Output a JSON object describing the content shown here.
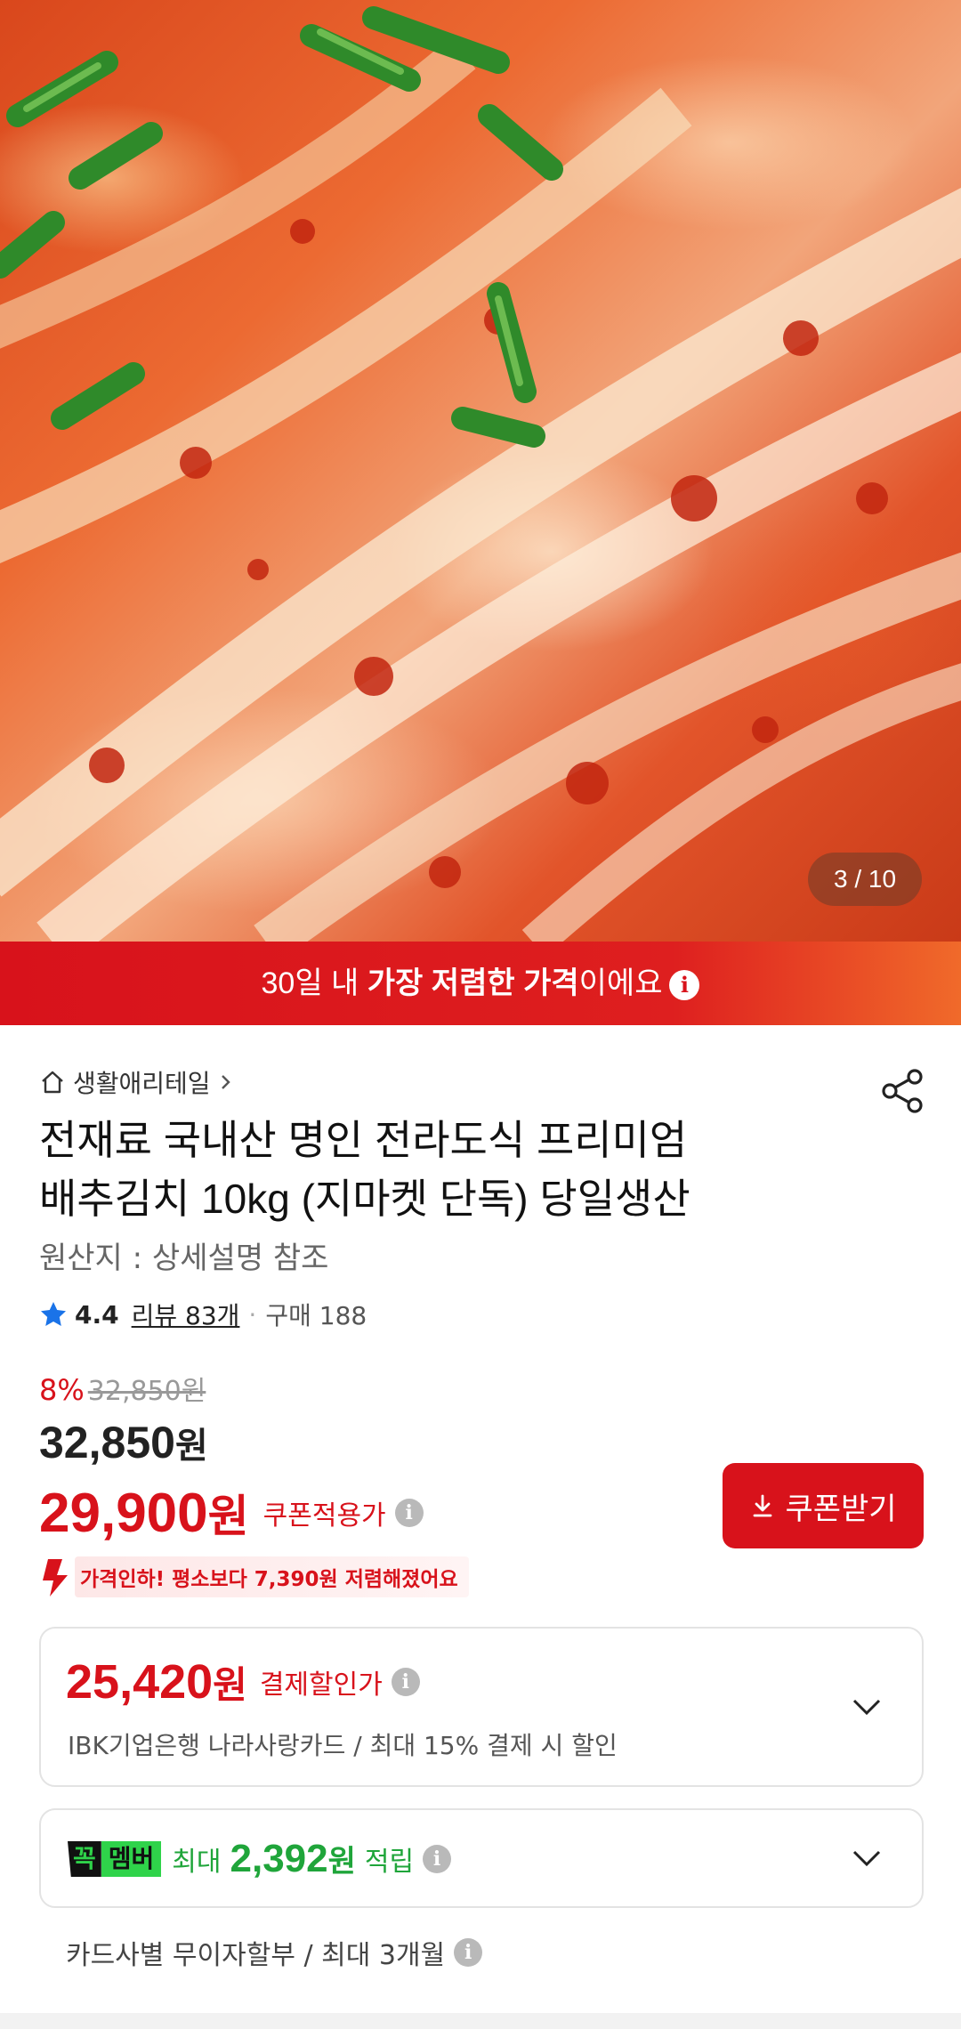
{
  "gallery": {
    "indicator": "3 / 10"
  },
  "banner": {
    "prefix": "30일 내 ",
    "highlight": "가장 저렴한 가격",
    "suffix": "이에요",
    "info_glyph": "i"
  },
  "seller": {
    "name": "생활애리테일",
    "icon": "home-icon"
  },
  "product": {
    "title_line1": "전재료 국내산 명인 전라도식 프리미엄",
    "title_line2": "배추김치 10kg  (지마켓 단독) 당일생산",
    "origin": "원산지 : 상세설명 참조"
  },
  "rating": {
    "score": "4.4",
    "review_link": "리뷰 83개",
    "separator": "·",
    "purchases": "구매 188"
  },
  "price": {
    "discount_rate": "8%",
    "original": "32,850원",
    "sale_amount": "32,850",
    "sale_unit": "원",
    "coupon_amount": "29,900",
    "coupon_unit": "원",
    "coupon_label": "쿠폰적용가",
    "price_drop": "가격인하! 평소보다 7,390원 저렴해졌어요"
  },
  "coupon_button": {
    "label": "쿠폰받기",
    "icon": "download-icon"
  },
  "payment_card": {
    "amount": "25,420",
    "unit": "원",
    "label": "결제할인가",
    "description": "IBK기업은행 나라사랑카드 / 최대 15% 결제 시 할인"
  },
  "member_card": {
    "badge_left": "꼭",
    "badge_right": "멤버",
    "prefix": "최대",
    "amount": "2,392",
    "unit": "원",
    "suffix": "적립"
  },
  "installment": {
    "text": "카드사별 무이자할부 / 최대 3개월"
  },
  "colors": {
    "accent": "#d8121b",
    "member_green": "#1fa53a",
    "badge_green": "#2fd34a",
    "star_blue": "#1a73e8"
  }
}
